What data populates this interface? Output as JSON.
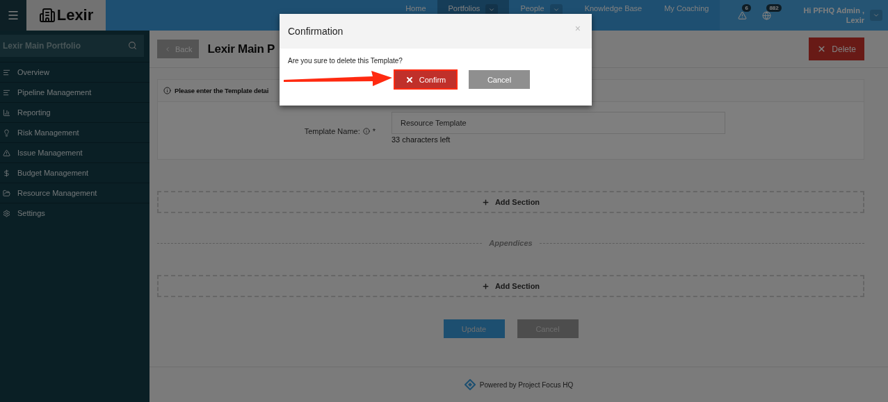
{
  "header": {
    "logo": "Lexir",
    "nav": [
      {
        "label": "Home",
        "selected": false,
        "dropdown": false
      },
      {
        "label": "Portfolios",
        "selected": true,
        "dropdown": true
      },
      {
        "label": "People",
        "selected": false,
        "dropdown": true
      },
      {
        "label": "Knowledge Base",
        "selected": false,
        "dropdown": false
      },
      {
        "label": "My Coaching",
        "selected": false,
        "dropdown": false
      }
    ],
    "alerts": "6",
    "notifications": "882",
    "user": {
      "greeting": "Hi PFHQ Admin ,",
      "name": "Lexir"
    }
  },
  "sidebar": {
    "search": {
      "placeholder": "Lexir Main Portfolio"
    },
    "items": [
      {
        "label": "Overview"
      },
      {
        "label": "Pipeline Management"
      },
      {
        "label": "Reporting"
      },
      {
        "label": "Risk Management"
      },
      {
        "label": "Issue Management"
      },
      {
        "label": "Budget Management"
      },
      {
        "label": "Resource Management"
      },
      {
        "label": "Settings"
      }
    ]
  },
  "toolbar": {
    "back": "Back",
    "title": "Lexir Main P",
    "delete": "Delete"
  },
  "form": {
    "heading": "Please enter the Template detai",
    "label": "Template Name:",
    "required": "*",
    "value": "Resource Template",
    "hint": "33 characters left"
  },
  "sections": [
    {
      "add": "Add Section"
    },
    {
      "divider": "Appendices",
      "add": "Add Section"
    }
  ],
  "actions": {
    "update": "Update",
    "cancel": "Cancel"
  },
  "footer": "Powered by Project Focus HQ",
  "modal": {
    "title": "Confirmation",
    "close": "×",
    "message": "Are you sure to delete this Template?",
    "confirm": "Confirm",
    "cancel": "Cancel"
  }
}
